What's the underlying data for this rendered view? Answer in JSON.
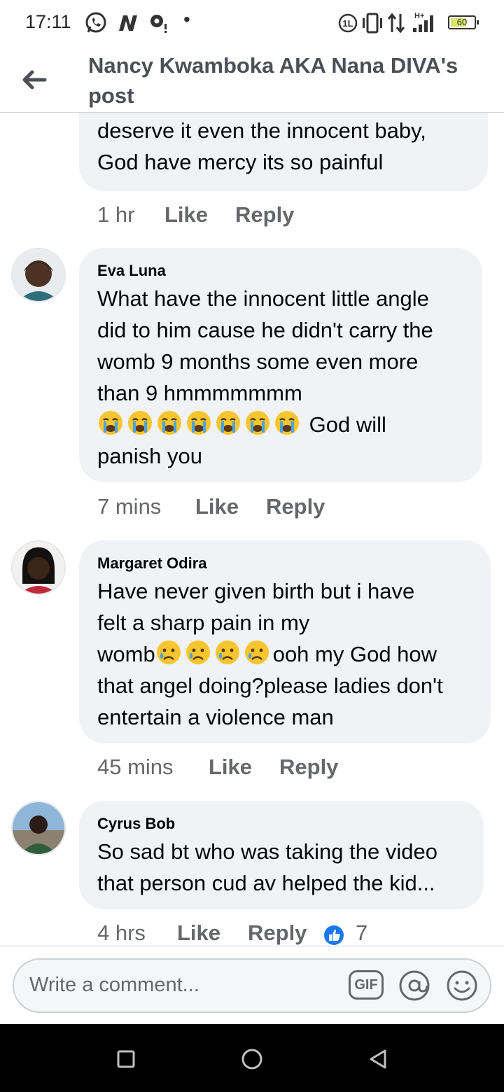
{
  "status_bar": {
    "time": "17:11",
    "battery": "60"
  },
  "header": {
    "title": "Nancy Kwamboka AKA Nana DIVA's post",
    "back_icon": "back-arrow-icon"
  },
  "comments": [
    {
      "name": "",
      "text": "deserve it even the innocent baby, God have mercy its so painful",
      "time": "1 hr",
      "like": "Like",
      "reply": "Reply"
    },
    {
      "name": "Eva Luna",
      "text_lines": [
        "What have the innocent little angle",
        "did to him cause he didn't carry the",
        "womb 9 months some even more",
        "than 9 hmmmmmmm"
      ],
      "emoji_text": "God will",
      "last_line": "panish you",
      "time": "7 mins",
      "like": "Like",
      "reply": "Reply"
    },
    {
      "name": "Margaret Odira",
      "line1": "Have never given birth but i have",
      "line2": "felt a sharp pain in my",
      "line3_start": "womb",
      "line3_end": "ooh my God how",
      "line4": "that angel doing?please ladies don't",
      "line5": "entertain a violence man",
      "time": "45 mins",
      "like": "Like",
      "reply": "Reply"
    },
    {
      "name": "Cyrus Bob",
      "text_lines": [
        "So sad bt who was taking the video",
        "that person cud av helped the kid..."
      ],
      "time": "4 hrs",
      "like": "Like",
      "reply": "Reply",
      "reaction_count": "7"
    }
  ],
  "composer": {
    "placeholder": "Write a comment...",
    "gif": "GIF"
  },
  "colors": {
    "bubble": "#f0f2f5",
    "meta": "#65676b",
    "like_blue": "#1877f2"
  }
}
